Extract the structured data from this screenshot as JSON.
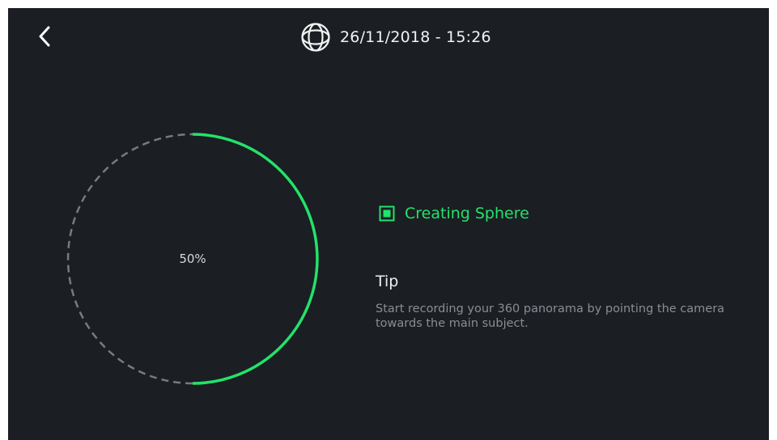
{
  "header": {
    "datetime": "26/11/2018 - 15:26",
    "mode_icon": "globe-sphere-icon"
  },
  "progress": {
    "percent_label": "50%",
    "fraction": 0.5,
    "complete_color": "#22e36a",
    "remaining_color": "#7a7a7a"
  },
  "status": {
    "icon": "record-icon",
    "label": "Creating Sphere",
    "color": "#22e36a"
  },
  "tip": {
    "title": "Tip",
    "text": "Start recording your 360 panorama by pointing the camera towards the main subject."
  },
  "colors": {
    "background": "#1b1e23"
  }
}
